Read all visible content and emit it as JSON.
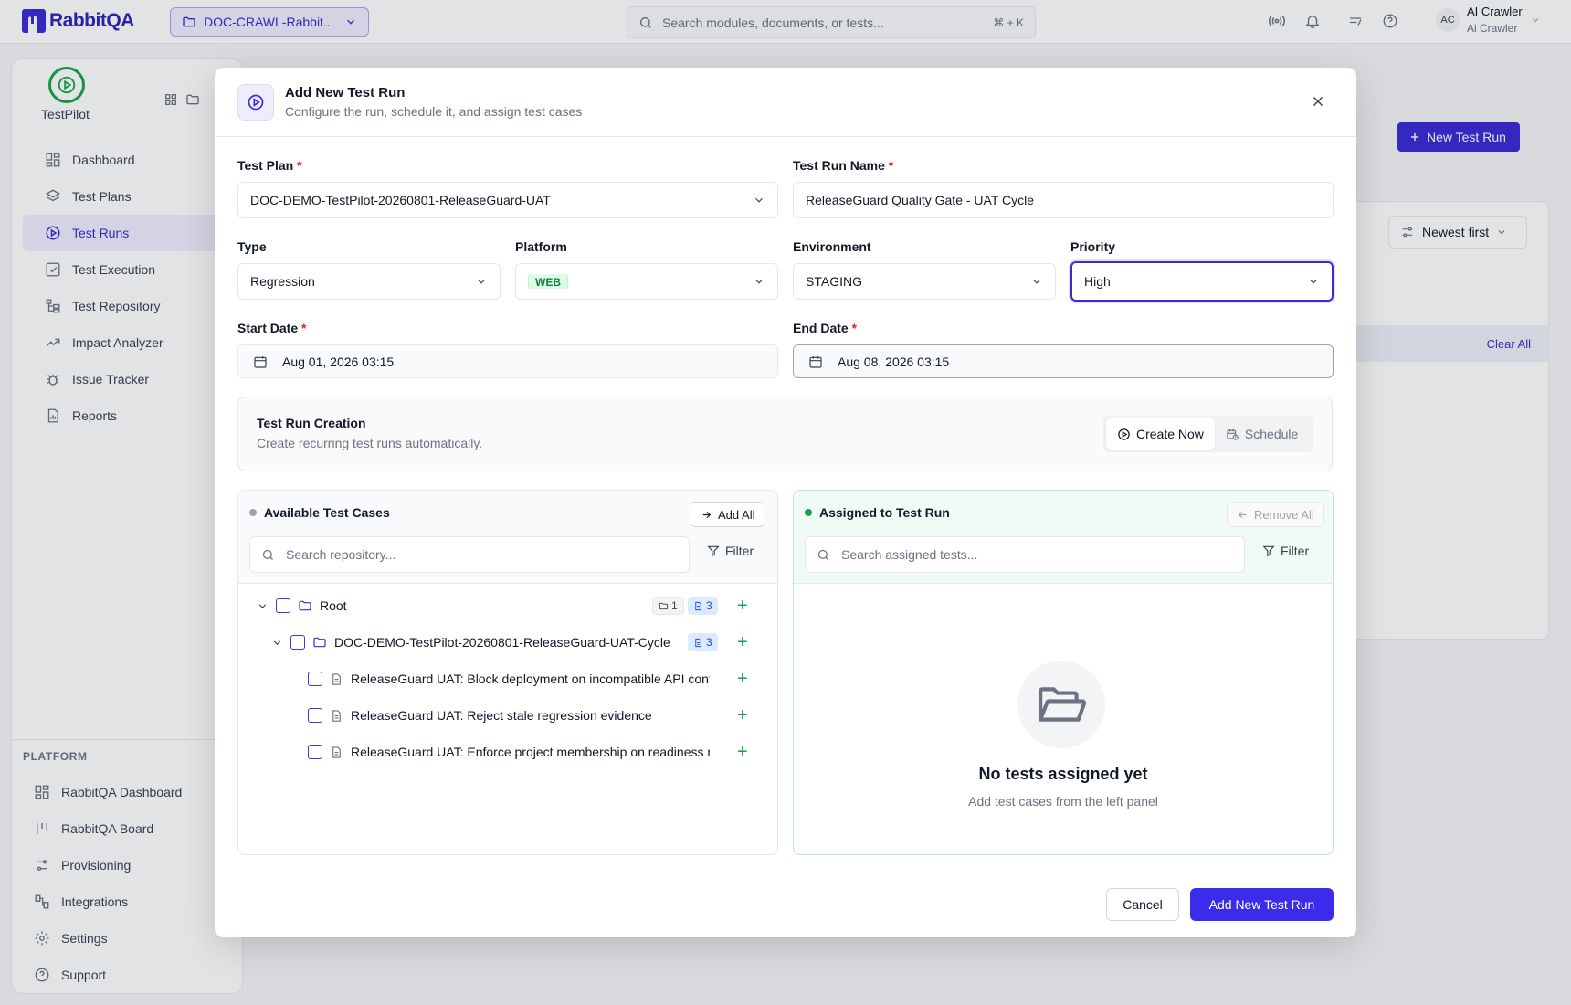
{
  "app": {
    "name": "RabbitQA"
  },
  "topbar": {
    "project": "DOC-CRAWL-Rabbit...",
    "search_placeholder": "Search modules, documents, or tests...",
    "search_shortcut": "⌘ + K",
    "user_initials": "AC",
    "user_name": "AI Crawler",
    "user_role": "Ai Crawler"
  },
  "sidebar": {
    "module": "TestPilot",
    "items": [
      {
        "label": "Dashboard",
        "icon": "grid-icon"
      },
      {
        "label": "Test Plans",
        "icon": "layers-icon"
      },
      {
        "label": "Test Runs",
        "icon": "play-circle-icon",
        "active": true
      },
      {
        "label": "Test Execution",
        "icon": "check-square-icon"
      },
      {
        "label": "Test Repository",
        "icon": "tree-icon"
      },
      {
        "label": "Impact Analyzer",
        "icon": "trend-icon"
      },
      {
        "label": "Issue Tracker",
        "icon": "bug-icon"
      },
      {
        "label": "Reports",
        "icon": "report-icon"
      }
    ],
    "platform_title": "PLATFORM",
    "platform_items": [
      {
        "label": "RabbitQA Dashboard"
      },
      {
        "label": "RabbitQA Board"
      },
      {
        "label": "Provisioning"
      },
      {
        "label": "Integrations"
      },
      {
        "label": "Settings"
      },
      {
        "label": "Support"
      }
    ]
  },
  "background": {
    "new_run_button": "New Test Run",
    "sort_label": "Newest first",
    "clear_all": "Clear All"
  },
  "modal": {
    "title": "Add New Test Run",
    "subtitle": "Configure the run, schedule it, and assign test cases",
    "test_plan": {
      "label": "Test Plan",
      "value": "DOC-DEMO-TestPilot-20260801-ReleaseGuard-UAT"
    },
    "test_run_name": {
      "label": "Test Run Name",
      "value": "ReleaseGuard Quality Gate - UAT Cycle"
    },
    "type": {
      "label": "Type",
      "value": "Regression"
    },
    "platform": {
      "label": "Platform",
      "value": "WEB"
    },
    "environment": {
      "label": "Environment",
      "value": "STAGING"
    },
    "priority": {
      "label": "Priority",
      "value": "High"
    },
    "start_date": {
      "label": "Start Date",
      "value": "Aug 01, 2026 03:15"
    },
    "end_date": {
      "label": "End Date",
      "value": "Aug 08, 2026 03:15"
    },
    "required_mark": "*",
    "creation": {
      "title": "Test Run Creation",
      "subtitle": "Create recurring test runs automatically.",
      "create_now": "Create Now",
      "schedule": "Schedule"
    },
    "available": {
      "title": "Available Test Cases",
      "add_all": "Add All",
      "search_placeholder": "Search repository...",
      "filter": "Filter",
      "root": {
        "name": "Root",
        "folder_count": "1",
        "case_count": "3"
      },
      "folder": {
        "name": "DOC-DEMO-TestPilot-20260801-ReleaseGuard-UAT-Cycle",
        "case_count": "3"
      },
      "cases": [
        "ReleaseGuard UAT: Block deployment on incompatible API contr...",
        "ReleaseGuard UAT: Reject stale regression evidence",
        "ReleaseGuard UAT: Enforce project membership on readiness re..."
      ]
    },
    "assigned": {
      "title": "Assigned to Test Run",
      "remove_all": "Remove All",
      "search_placeholder": "Search assigned tests...",
      "filter": "Filter",
      "empty_title": "No tests assigned yet",
      "empty_subtitle": "Add test cases from the left panel"
    },
    "cancel": "Cancel",
    "submit": "Add New Test Run"
  },
  "colors": {
    "accent": "#3b2bd6",
    "success": "#16a34a",
    "required": "#dc2626"
  }
}
